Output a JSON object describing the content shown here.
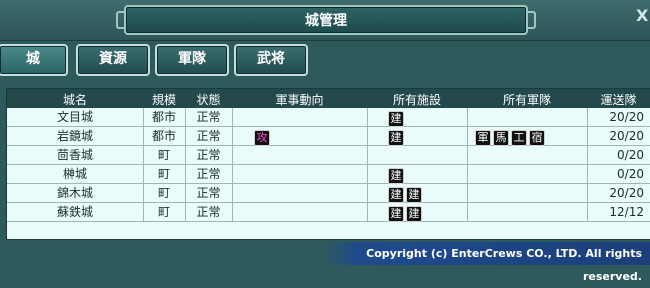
{
  "window": {
    "title": "城管理",
    "close_label": "X"
  },
  "tabs": [
    {
      "label": "城"
    },
    {
      "label": "資源"
    },
    {
      "label": "軍隊"
    },
    {
      "label": "武将"
    }
  ],
  "table": {
    "headers": [
      "城名",
      "規模",
      "状態",
      "軍事動向",
      "所有施設",
      "所有軍隊",
      "運送隊"
    ],
    "rows": [
      {
        "name": "文目城",
        "scale": "都市",
        "status": "正常",
        "military": [],
        "facilities": [
          "建"
        ],
        "army": [],
        "transport": "20/20"
      },
      {
        "name": "岩鏡城",
        "scale": "都市",
        "status": "正常",
        "military": [
          "攻"
        ],
        "facilities": [
          "建"
        ],
        "army": [
          "軍",
          "馬",
          "工",
          "宿"
        ],
        "transport": "20/20"
      },
      {
        "name": "茴香城",
        "scale": "町",
        "status": "正常",
        "military": [],
        "facilities": [],
        "army": [],
        "transport": "0/20"
      },
      {
        "name": "榊城",
        "scale": "町",
        "status": "正常",
        "military": [],
        "facilities": [
          "建"
        ],
        "army": [],
        "transport": "0/20"
      },
      {
        "name": "錦木城",
        "scale": "町",
        "status": "正常",
        "military": [],
        "facilities": [
          "建",
          "建"
        ],
        "army": [],
        "transport": "20/20"
      },
      {
        "name": "蘇鉄城",
        "scale": "町",
        "status": "正常",
        "military": [],
        "facilities": [
          "建",
          "建"
        ],
        "army": [],
        "transport": "12/12"
      }
    ]
  },
  "footer": {
    "copyright": "Copyright (c) EnterCrews CO., LTD. All rights reserved."
  }
}
